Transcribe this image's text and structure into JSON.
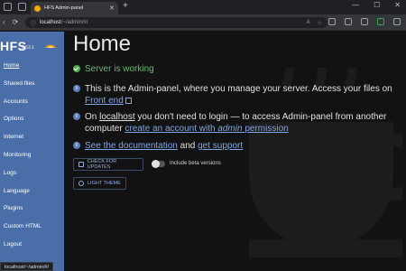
{
  "browser": {
    "tab_title": "HFS Admin-panel",
    "url_host": "localhost",
    "url_path": "/~/admin/#/"
  },
  "sidebar": {
    "brand": "HFS",
    "version": "0.53.1",
    "items": [
      {
        "label": "Home",
        "active": true
      },
      {
        "label": "Shared files"
      },
      {
        "label": "Accounts"
      },
      {
        "label": "Options"
      },
      {
        "label": "Internet"
      },
      {
        "label": "Monitoring"
      },
      {
        "label": "Logs"
      },
      {
        "label": "Language"
      },
      {
        "label": "Plugins"
      },
      {
        "label": "Custom HTML"
      },
      {
        "label": "Logout"
      }
    ]
  },
  "main": {
    "title": "Home",
    "status": "Server is working",
    "intro_text": "This is the Admin-panel, where you manage your server. Access your files on ",
    "intro_link": "Front end",
    "localhost_pre": "On ",
    "localhost_word": "localhost",
    "localhost_mid": " you don't need to login — to access Admin-panel from another computer ",
    "create_link_a": "create an account with ",
    "create_link_b": "admin",
    "create_link_c": " permission",
    "docs_link": "See the documentation",
    "and_text": " and ",
    "support_link": "get support",
    "check_updates": "CHECK FOR UPDATES",
    "beta_label": "Include beta versions",
    "light_theme": "LIGHT THEME"
  },
  "statusbar": {
    "text": "localhost/~/admin/#/"
  },
  "colors": {
    "sidebar": "#4a6fa8",
    "background": "#121212",
    "link": "#7fa6e6",
    "status_green": "#66bb6a"
  }
}
